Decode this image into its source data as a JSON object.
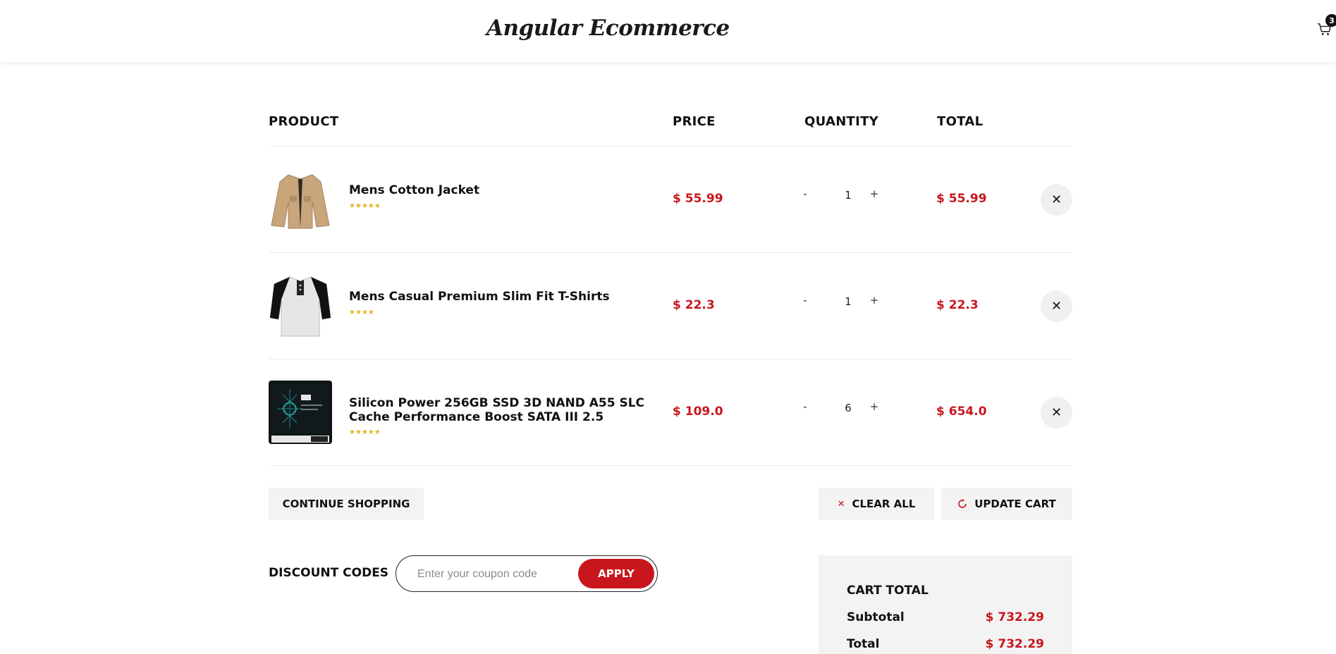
{
  "header": {
    "brand": "Angular Ecommerce",
    "cart_count": "3",
    "cart_icon": "cart-icon"
  },
  "columns": {
    "product": "PRODUCT",
    "price": "PRICE",
    "quantity": "QUANTITY",
    "total": "TOTAL"
  },
  "items": [
    {
      "name": "Mens Cotton Jacket",
      "rating_stars": 5,
      "price": "$ 55.99",
      "quantity": "1",
      "total": "$ 55.99",
      "minus": "-",
      "plus": "+",
      "remove": "✕"
    },
    {
      "name": "Mens Casual Premium Slim Fit T-Shirts",
      "rating_stars": 4,
      "price": "$ 22.3",
      "quantity": "1",
      "total": "$ 22.3",
      "minus": "-",
      "plus": "+",
      "remove": "✕"
    },
    {
      "name": "Silicon Power 256GB SSD 3D NAND A55 SLC Cache Performance Boost SATA III 2.5",
      "rating_stars": 5,
      "price": "$ 109.0",
      "quantity": "6",
      "total": "$ 654.0",
      "minus": "-",
      "plus": "+",
      "remove": "✕"
    }
  ],
  "actions": {
    "continue": "CONTINUE SHOPPING",
    "clear_all": "CLEAR ALL",
    "update_cart": "UPDATE CART"
  },
  "discount": {
    "label": "DISCOUNT CODES",
    "placeholder": "Enter your coupon code",
    "apply": "APPLY"
  },
  "cart_total": {
    "title": "CART TOTAL",
    "subtotal_label": "Subtotal",
    "subtotal_value": "$ 732.29",
    "total_label": "Total",
    "total_value": "$ 732.29"
  },
  "colors": {
    "accent": "#c8161d",
    "star": "#e3b522",
    "button_bg": "#f3f3f3"
  }
}
